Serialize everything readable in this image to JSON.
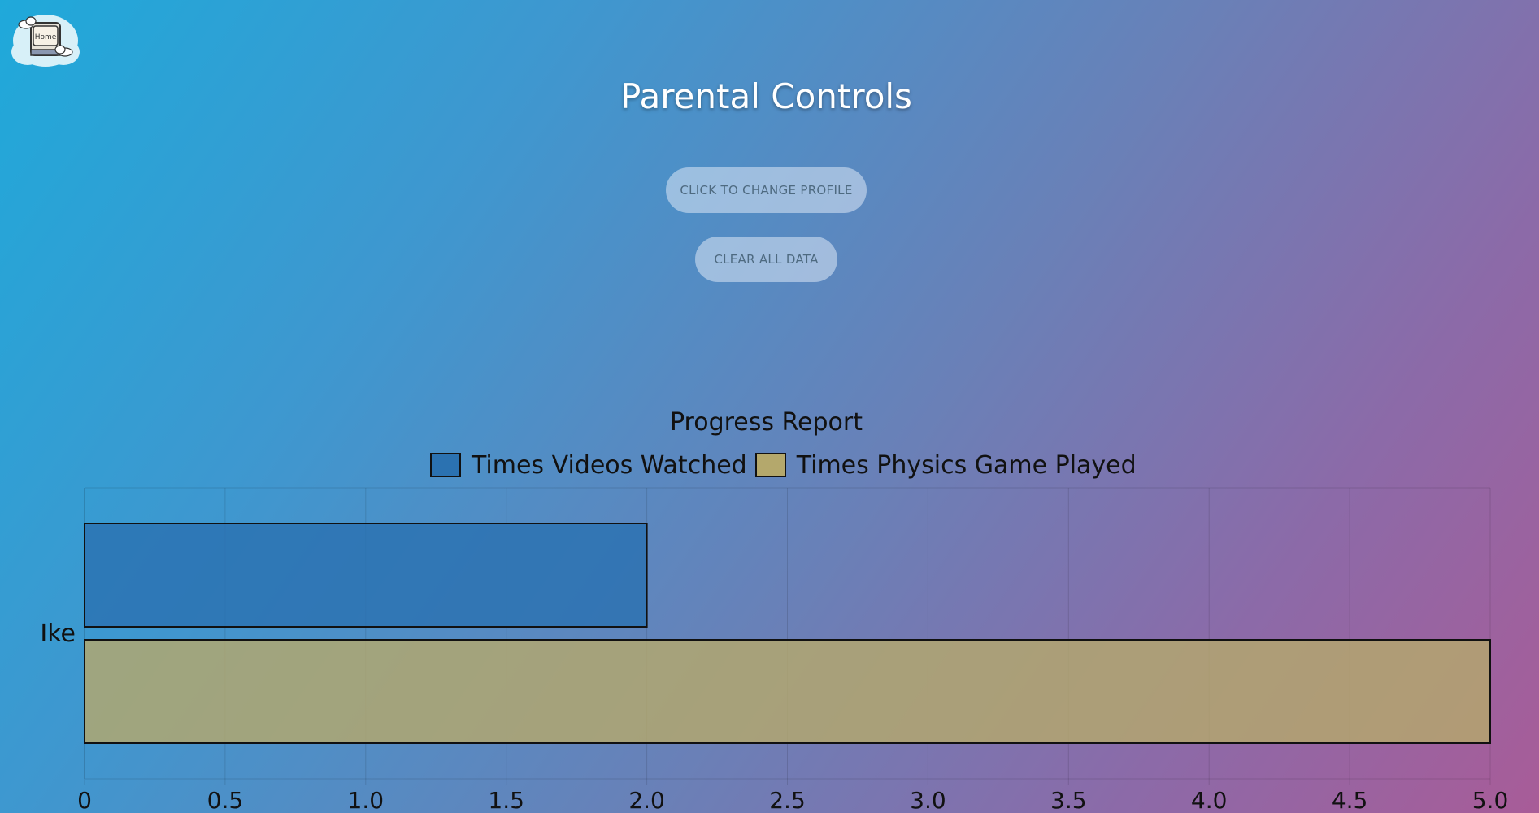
{
  "header": {
    "home_label": "Home",
    "title": "Parental Controls"
  },
  "buttons": {
    "change_profile": "CLICK TO CHANGE PROFILE",
    "clear_data": "CLEAR ALL DATA"
  },
  "colors": {
    "videos": "#2b72b1",
    "physics": "#b4a86c",
    "button_text": "#4e6a80"
  },
  "chart_data": {
    "type": "bar",
    "orientation": "horizontal",
    "title": "Progress Report",
    "categories": [
      "Ike"
    ],
    "series": [
      {
        "name": "Times Videos Watched",
        "values": [
          2
        ]
      },
      {
        "name": "Times Physics Game Played",
        "values": [
          5
        ]
      }
    ],
    "xlim": [
      0,
      5
    ],
    "xticks": [
      "0",
      "0.5",
      "1.0",
      "1.5",
      "2.0",
      "2.5",
      "3.0",
      "3.5",
      "4.0",
      "4.5",
      "5.0"
    ],
    "grid": true,
    "legend": "top"
  }
}
